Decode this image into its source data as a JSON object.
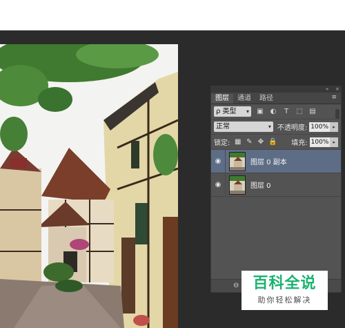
{
  "panel": {
    "tabs": [
      "图层",
      "通道",
      "路径"
    ],
    "active_tab": 0,
    "filter": {
      "label": "ρ 类型"
    },
    "blend_mode": "正常",
    "opacity": {
      "label": "不透明度:",
      "value": "100%"
    },
    "lock_label": "锁定:",
    "fill": {
      "label": "填充:",
      "value": "100%"
    },
    "layers": [
      {
        "name": "图层 0 副本",
        "selected": true
      },
      {
        "name": "图层 0",
        "selected": false
      }
    ]
  },
  "watermark": {
    "title": "百科全说",
    "subtitle": "助你轻松解决"
  },
  "colors": {
    "selected_layer": "#5e6d86",
    "panel_bg": "#535353",
    "workspace": "#2b2b2b",
    "watermark_green": "#1bb270"
  },
  "photo": {
    "description_icon": "street-photo-image"
  }
}
